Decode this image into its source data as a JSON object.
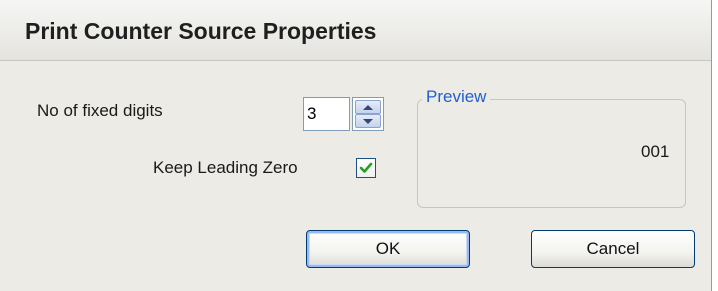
{
  "dialog": {
    "title": "Print Counter Source Properties",
    "fixed_digits_label": "No of fixed digits",
    "fixed_digits_value": "3",
    "keep_leading_zero_label": "Keep Leading Zero",
    "keep_leading_zero_checked": true,
    "preview_legend": "Preview",
    "preview_value": "001",
    "ok_label": "OK",
    "cancel_label": "Cancel"
  },
  "colors": {
    "accent": "#1f5fd3",
    "checkmark": "#21a121",
    "button_border": "#003c74"
  }
}
